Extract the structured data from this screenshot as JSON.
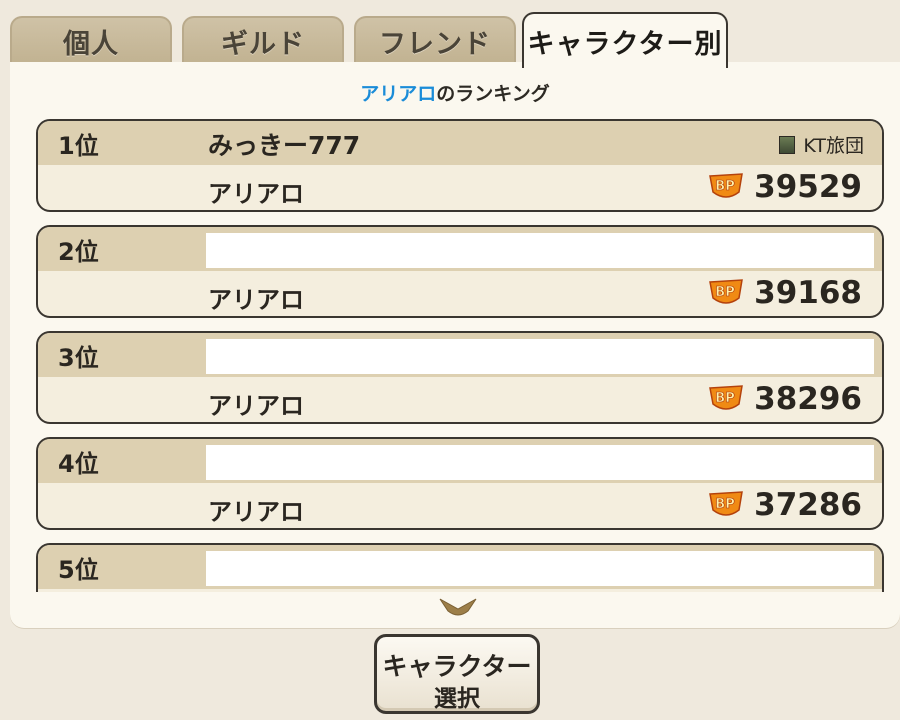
{
  "tabs": {
    "personal": "個人",
    "guild": "ギルド",
    "friend": "フレンド",
    "character": "キャラクター別"
  },
  "ranking": {
    "character": "アリアロ",
    "title_suffix": "のランキング"
  },
  "entries": [
    {
      "rank": "1位",
      "player": "みっきー777",
      "guild": "KT旅団",
      "guild_icon": "guild-emblem-icon",
      "character": "アリアロ",
      "bp": "39529"
    },
    {
      "rank": "2位",
      "player": "",
      "character": "アリアロ",
      "bp": "39168"
    },
    {
      "rank": "3位",
      "player": "",
      "character": "アリアロ",
      "bp": "38296"
    },
    {
      "rank": "4位",
      "player": "",
      "character": "アリアロ",
      "bp": "37286"
    },
    {
      "rank": "5位",
      "player": ""
    }
  ],
  "icons": {
    "bp": "bp-badge-icon",
    "scroll": "chevron-down-icon"
  },
  "colors": {
    "accent_blue": "#1a8cd8",
    "row_header": "#ddd0b1",
    "bp_orange": "#f08a14"
  },
  "select_button": {
    "line1": "キャラクター",
    "line2": "選択"
  }
}
